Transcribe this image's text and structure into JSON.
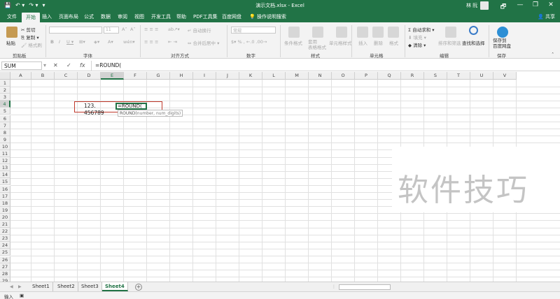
{
  "titlebar": {
    "title": "演示文档.xlsx  -  Excel",
    "user": "林 阮",
    "qa": [
      "💾",
      "↶ ▾",
      "↷ ▾",
      "▾"
    ],
    "win_restore": "🗗",
    "win_min": "—",
    "win_max": "❐",
    "win_close": "✕"
  },
  "tabs": {
    "items": [
      "文件",
      "开始",
      "插入",
      "页面布局",
      "公式",
      "数据",
      "审阅",
      "视图",
      "开发工具",
      "帮助",
      "PDF工具集",
      "百度网盘"
    ],
    "tellme": "操作说明搜索",
    "share": "共享"
  },
  "ribbon": {
    "clipboard": {
      "paste": "粘贴",
      "cut": "剪切",
      "copy": "复制 ▾",
      "painter": "格式刷",
      "label": "剪贴板"
    },
    "font": {
      "bold": "B",
      "italic": "I",
      "underline": "U ▾",
      "size": "11",
      "grow": "A˄",
      "shrink": "A˅",
      "label": "字体"
    },
    "alignment": {
      "wrap": "自动换行",
      "merge": "合并后居中 ▾",
      "label": "对齐方式"
    },
    "number": {
      "format": "常规",
      "label": "数字"
    },
    "styles": {
      "conditional": "条件格式",
      "table": "套用\n表格格式",
      "cell": "单元格样式",
      "label": "样式"
    },
    "cells": {
      "insert": "插入",
      "delete": "删除",
      "format": "格式",
      "label": "单元格"
    },
    "editing": {
      "autosum": "自动求和 ▾",
      "fill": "填充 ▾",
      "clear": "清除 ▾",
      "sort": "排序和筛选",
      "find": "查找和选择",
      "label": "编辑"
    },
    "save": {
      "button": "保存到\n百度网盘",
      "label": "保存"
    }
  },
  "formula_bar": {
    "name_box": "SUM",
    "cancel": "✕",
    "enter": "✓",
    "fx": "fx",
    "content": "=ROUND("
  },
  "grid": {
    "columns": [
      "A",
      "B",
      "C",
      "D",
      "E",
      "F",
      "G",
      "H",
      "I",
      "J",
      "K",
      "L",
      "M",
      "N",
      "O",
      "P",
      "Q",
      "R",
      "S",
      "T",
      "U",
      "V"
    ],
    "rows": [
      "1",
      "2",
      "3",
      "4",
      "5",
      "6",
      "7",
      "8",
      "9",
      "10",
      "11",
      "12",
      "13",
      "14",
      "15",
      "16",
      "17",
      "18",
      "19",
      "20",
      "21",
      "22",
      "23",
      "24",
      "25",
      "26",
      "27",
      "28",
      "29"
    ],
    "selected_col": "E",
    "selected_row": "4",
    "d4_value": "123. 456789",
    "e4_edit": "=ROUND(",
    "tooltip_fn": "ROUND(",
    "tooltip_args": "number, num_digits)"
  },
  "watermark": "软件技巧",
  "sheets": {
    "tabs": [
      "Sheet1",
      "Sheet2",
      "Sheet3",
      "Sheet4"
    ],
    "active": "Sheet4",
    "add": "+"
  },
  "status": {
    "mode": "输入",
    "icon": "▣"
  },
  "colors": {
    "accent": "#217346",
    "highlight": "#c0392b"
  }
}
